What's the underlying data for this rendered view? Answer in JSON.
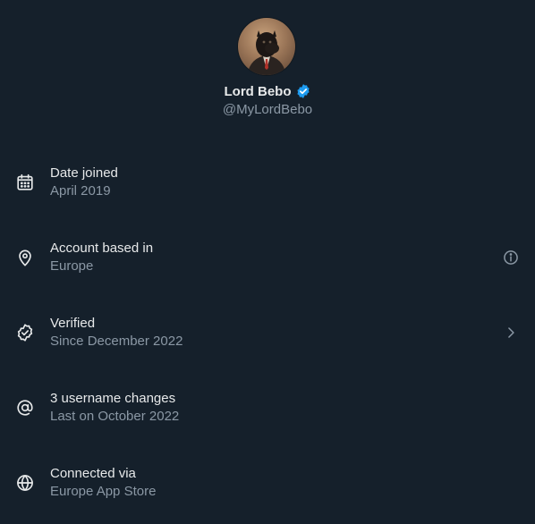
{
  "profile": {
    "display_name": "Lord Bebo",
    "handle": "@MyLordBebo",
    "verified_color": "#1d9bf0"
  },
  "info_rows": [
    {
      "icon": "calendar-icon",
      "title": "Date joined",
      "value": "April 2019",
      "trailing": null
    },
    {
      "icon": "location-pin-icon",
      "title": "Account based in",
      "value": "Europe",
      "trailing": "info-icon"
    },
    {
      "icon": "verified-badge-icon",
      "title": "Verified",
      "value": "Since December 2022",
      "trailing": "chevron-right-icon"
    },
    {
      "icon": "at-sign-icon",
      "title": "3 username changes",
      "value": "Last on October 2022",
      "trailing": null
    },
    {
      "icon": "globe-icon",
      "title": "Connected via",
      "value": "Europe App Store",
      "trailing": null
    }
  ],
  "colors": {
    "background": "#15202b",
    "primary_text": "#e7e9ea",
    "secondary_text": "#8b98a5",
    "accent": "#1d9bf0"
  }
}
